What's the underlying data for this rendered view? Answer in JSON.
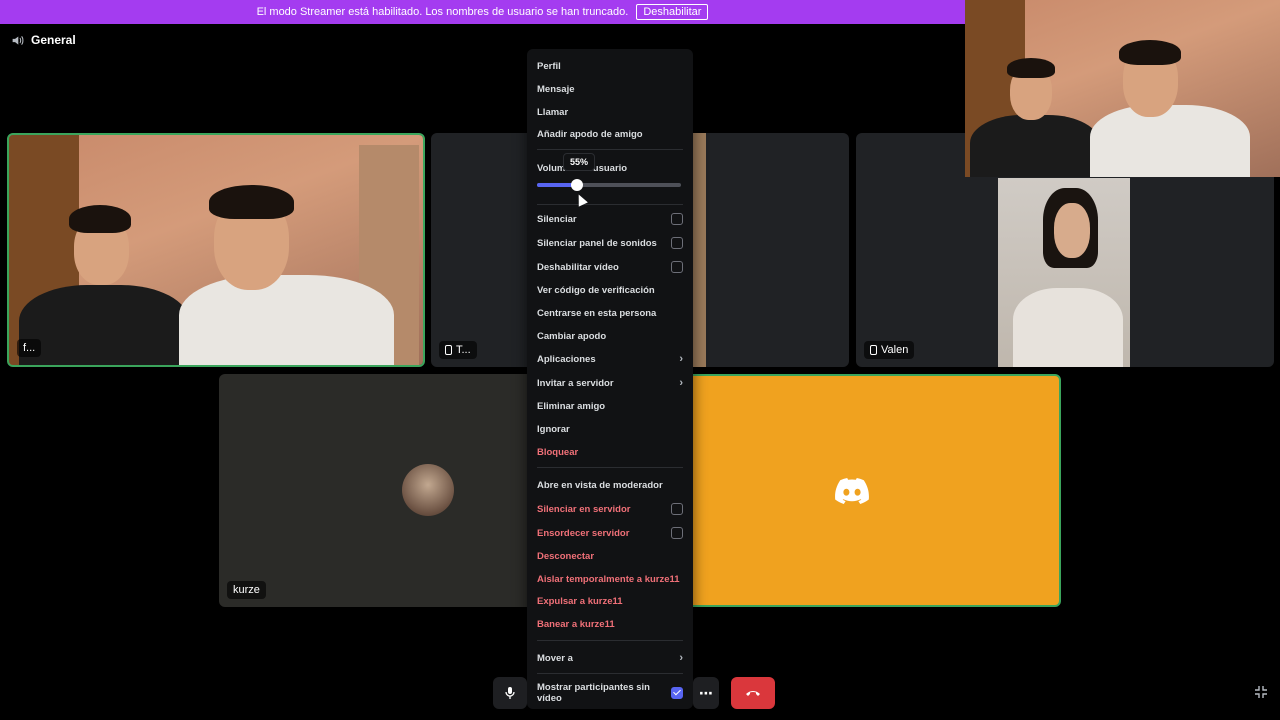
{
  "banner": {
    "text": "El modo Streamer está habilitado. Los nombres de usuario se han truncado.",
    "button": "Deshabilitar"
  },
  "channel": {
    "name": "General"
  },
  "tiles": {
    "tile1_label": "f...",
    "tile2_label": "T...",
    "tile3_label": "Valen",
    "tile4_label": "kurze"
  },
  "menu": {
    "profile": "Perfil",
    "message": "Mensaje",
    "call": "Llamar",
    "add_nickname": "Añadir apodo de amigo",
    "volume_label": "Volumen de usuario",
    "volume_tooltip": "55%",
    "volume_value": 55,
    "mute": "Silenciar",
    "mute_soundboard": "Silenciar panel de sonidos",
    "disable_video": "Deshabilitar vídeo",
    "view_code": "Ver código de verificación",
    "focus_person": "Centrarse en esta persona",
    "change_nickname": "Cambiar apodo",
    "apps": "Aplicaciones",
    "invite_server": "Invitar a servidor",
    "remove_friend": "Eliminar amigo",
    "ignore": "Ignorar",
    "block": "Bloquear",
    "mod_view": "Abre en vista de moderador",
    "server_mute": "Silenciar en servidor",
    "server_deafen": "Ensordecer servidor",
    "disconnect": "Desconectar",
    "timeout": "Aislar temporalmente a kurze11",
    "kick": "Expulsar a kurze11",
    "ban": "Banear a kurze11",
    "move_to": "Mover a",
    "show_no_video": "Mostrar participantes sin vídeo"
  },
  "colors": {
    "accent": "#5865f2",
    "danger": "#f07078",
    "banner": "#a43cf0",
    "hangup": "#da373c",
    "speaking": "#3ba55c"
  }
}
